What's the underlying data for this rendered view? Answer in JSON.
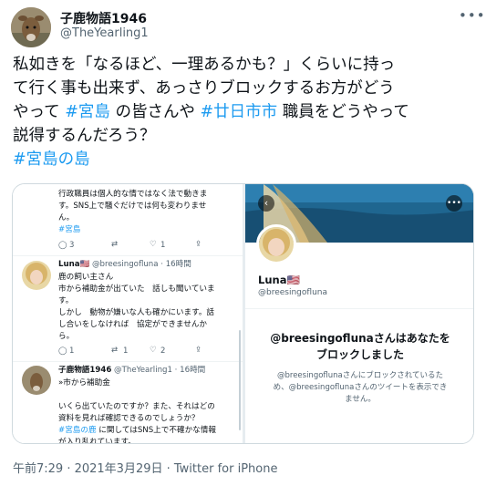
{
  "author": {
    "display_name": "子鹿物語1946",
    "handle": "@TheYearling1"
  },
  "tweet": {
    "line1": "私如きを「なるほど、一理あるかも？」くらいに持っ",
    "line2": "て行く事も出来ず、あっさりブロックするお方がどう",
    "line3_a": "やって ",
    "line3_tag1": "#宮島",
    "line3_b": " の皆さんや ",
    "line3_tag2": "#廿日市市",
    "line3_c": " 職員をどうやって",
    "line4": "説得するんだろう？",
    "hashtag": "#宮島の島"
  },
  "screenshot_left": {
    "top_tweet": {
      "line1": "行政職員は個人的な情ではなく法で動きま",
      "line2": "す。SNS上で騒ぐだけでは何も変わりませ",
      "line3": "ん。",
      "tag": "#宮島",
      "replies": "3",
      "likes": "1"
    },
    "luna_tweet": {
      "name": "Luna🇺🇸",
      "meta": "@breesingofluna · 16時間",
      "line1": "鹿の飼い主さん",
      "line2": "市から補助金が出ていた　話しも聞いていま",
      "line3": "す。",
      "line4": "しかし　動物が嫌いな人も確かにいます。話",
      "line5": "し合いをしなければ　協定ができませんか",
      "line6": "ら。",
      "replies": "1",
      "retweets": "1",
      "likes": "2"
    },
    "reply_tweet": {
      "name": "子鹿物語1946",
      "meta": "@TheYearling1 · 16時間",
      "line1": "»市から補助金",
      "line2": "いくら出ていたのですか？また、それはどの",
      "line3": "資料を見れば確認できるのでしょうか？",
      "line4_tag": "#宮島の鹿",
      "line4_rest": " に関してはSNS上で不確かな情報",
      "line5": "が入り乱れています。"
    }
  },
  "screenshot_right": {
    "name": "Luna🇺🇸",
    "handle": "@breesingofluna",
    "blocked_title_1": "@breesingoflunaさんはあなたを",
    "blocked_title_2": "ブロックしました",
    "blocked_desc_1": "@breesingoflunaさんにブロックされているた",
    "blocked_desc_2": "め、@breesingoflunaさんのツイートを表示でき",
    "blocked_desc_3": "ません。"
  },
  "footer": {
    "timestamp": "午前7:29 · 2021年3月29日 · Twitter for iPhone"
  },
  "icons": {
    "more": "more-icon",
    "reply": "reply-icon",
    "retweet": "retweet-icon",
    "like": "like-icon",
    "share": "share-icon",
    "back": "back-arrow-icon"
  },
  "colors": {
    "link": "#1d9bf0",
    "text": "#0f1419",
    "muted": "#536471"
  }
}
